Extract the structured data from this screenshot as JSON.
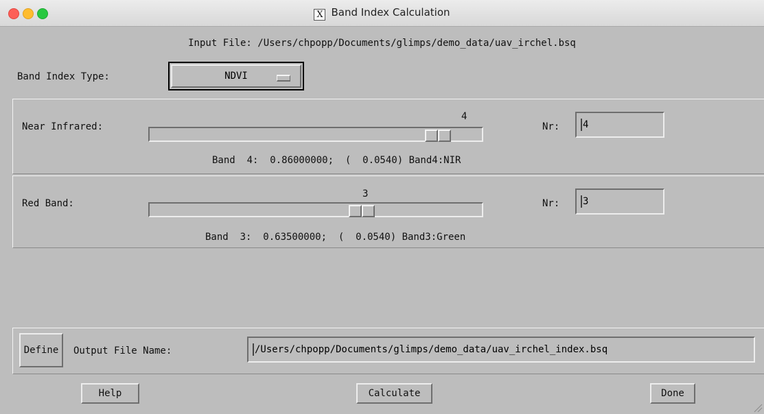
{
  "window": {
    "title": "Band Index Calculation"
  },
  "input_file": {
    "label": "Input File: /Users/chpopp/Documents/glimps/demo_data/uav_irchel.bsq"
  },
  "band_index_type": {
    "label": "Band Index Type:",
    "selected": "NDVI"
  },
  "near_infrared": {
    "label": "Near Infrared:",
    "slider_value": "4",
    "slider_position": 0.9,
    "nr_label": "Nr:",
    "nr_value": "4",
    "info": "Band  4:  0.86000000;  (  0.0540) Band4:NIR"
  },
  "red_band": {
    "label": "Red Band:",
    "slider_value": "3",
    "slider_position": 0.65,
    "nr_label": "Nr:",
    "nr_value": "3",
    "info": "Band  3:  0.63500000;  (  0.0540) Band3:Green"
  },
  "output": {
    "define_button": "Define",
    "label": "Output File Name:",
    "value": "/Users/chpopp/Documents/glimps/demo_data/uav_irchel_index.bsq"
  },
  "buttons": {
    "help": "Help",
    "calculate": "Calculate",
    "done": "Done"
  }
}
